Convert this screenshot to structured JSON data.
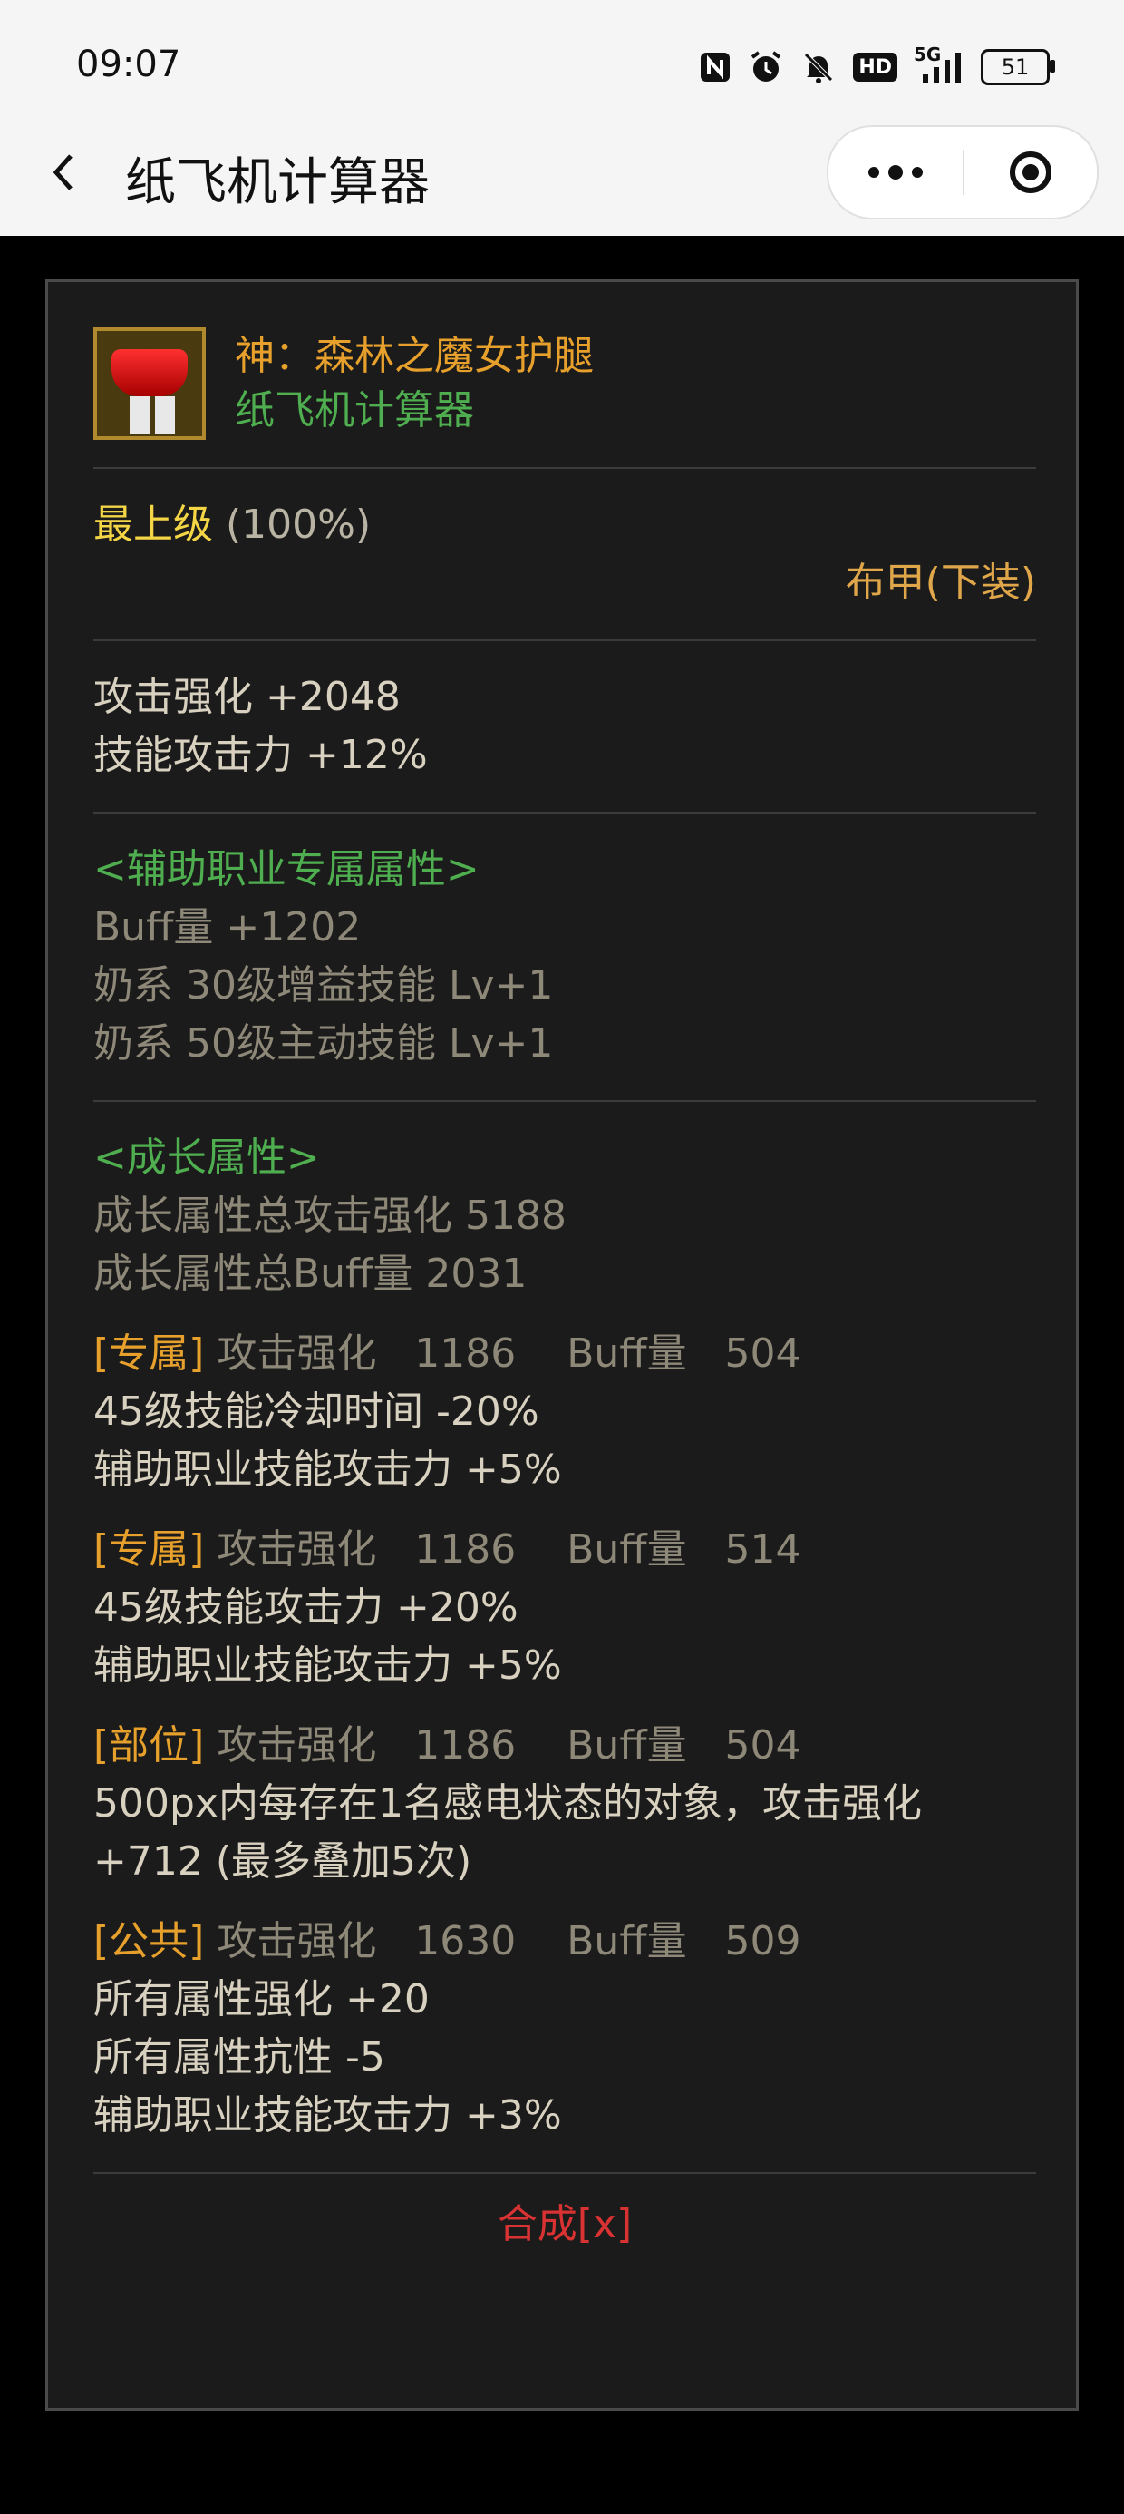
{
  "status_bar": {
    "time": "09:07",
    "icons": [
      "nfc-icon",
      "alarm-icon",
      "mute-icon",
      "hd-icon",
      "5g-signal-icon"
    ],
    "hd": "HD",
    "net": "5G",
    "battery": "51"
  },
  "nav": {
    "back": "‹",
    "title": "纸飞机计算器"
  },
  "item": {
    "name": "神：森林之魔女护腿",
    "subtitle": "纸飞机计算器",
    "grade": "最上级",
    "grade_pct": "(100%)",
    "slot": "布甲(下装)",
    "stats": [
      "攻击强化 +2048",
      "技能攻击力 +12%"
    ],
    "support": {
      "title": "<辅助职业专属属性>",
      "lines": [
        "Buff量 +1202",
        "奶系 30级增益技能 Lv+1",
        "奶系 50级主动技能 Lv+1"
      ]
    },
    "growth": {
      "title": "<成长属性>",
      "lines": [
        "成长属性总攻击强化 5188",
        "成长属性总Buff量 2031"
      ]
    },
    "options": [
      {
        "tag": "[专属]",
        "stats": " 攻击强化   1186    Buff量   504",
        "lines": [
          "45级技能冷却时间 -20%",
          "辅助职业技能攻击力 +5%"
        ]
      },
      {
        "tag": "[专属]",
        "stats": " 攻击强化   1186    Buff量   514",
        "lines": [
          "45级技能攻击力 +20%",
          "辅助职业技能攻击力 +5%"
        ]
      },
      {
        "tag": "[部位]",
        "stats": " 攻击强化   1186    Buff量   504",
        "lines": [
          "500px内每存在1名感电状态的对象，攻击强化",
          "+712 (最多叠加5次)"
        ]
      },
      {
        "tag": "[公共]",
        "stats": " 攻击强化   1630    Buff量   509",
        "lines": [
          "所有属性强化 +20",
          "所有属性抗性 -5",
          "辅助职业技能攻击力 +3%"
        ]
      }
    ],
    "synth": "合成[x]"
  }
}
